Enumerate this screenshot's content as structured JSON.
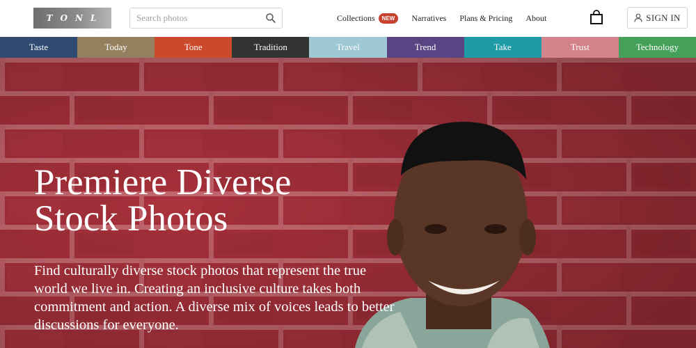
{
  "header": {
    "logo_text": "TONL",
    "search_placeholder": "Search photos",
    "nav": [
      {
        "label": "Collections",
        "badge": "NEW"
      },
      {
        "label": "Narratives"
      },
      {
        "label": "Plans & Pricing"
      },
      {
        "label": "About"
      }
    ],
    "sign_in_label": "SIGN IN"
  },
  "categories": [
    {
      "label": "Taste",
      "color": "#2f4b72"
    },
    {
      "label": "Today",
      "color": "#94805f"
    },
    {
      "label": "Tone",
      "color": "#cc4a2c"
    },
    {
      "label": "Tradition",
      "color": "#333333"
    },
    {
      "label": "Travel",
      "color": "#9ec8d3"
    },
    {
      "label": "Trend",
      "color": "#5a4584"
    },
    {
      "label": "Take",
      "color": "#1f9aa7"
    },
    {
      "label": "Trust",
      "color": "#d4838a"
    },
    {
      "label": "Technology",
      "color": "#45a15a"
    }
  ],
  "hero": {
    "title_line1": "Premiere Diverse",
    "title_line2": "Stock Photos",
    "description": "Find culturally diverse stock photos that represent the true world we live in. Creating an inclusive culture takes both commitment and action. A diverse mix of voices leads to better discussions for everyone."
  },
  "colors": {
    "badge": "#c8402e",
    "brick": "#a8303a",
    "mortar": "#c56870"
  }
}
